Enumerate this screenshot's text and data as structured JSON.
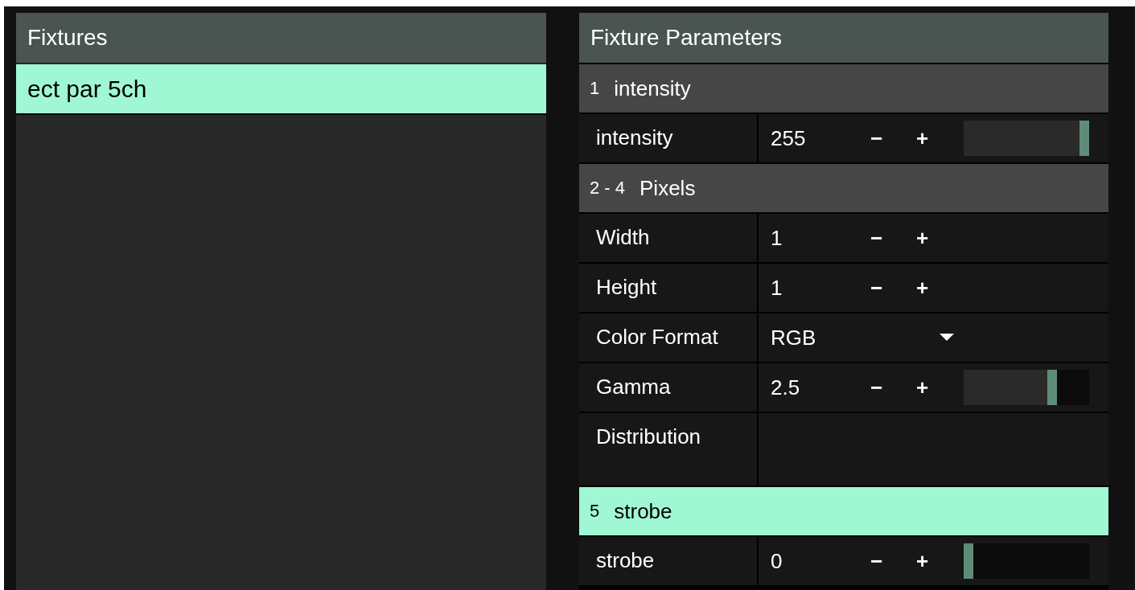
{
  "fixtures_panel": {
    "title": "Fixtures",
    "items": [
      {
        "label": "ect par 5ch",
        "selected": true
      }
    ]
  },
  "parameters_panel": {
    "title": "Fixture Parameters",
    "groups": [
      {
        "channel": "1",
        "name": "intensity",
        "selected": false,
        "params": [
          {
            "kind": "number",
            "label": "intensity",
            "value": "255",
            "minus": "−",
            "plus": "+",
            "level": 1
          }
        ]
      },
      {
        "channel": "2 - 4",
        "name": "Pixels",
        "selected": false,
        "params": [
          {
            "kind": "number",
            "label": "Width",
            "value": "1",
            "minus": "−",
            "plus": "+"
          },
          {
            "kind": "number",
            "label": "Height",
            "value": "1",
            "minus": "−",
            "plus": "+"
          },
          {
            "kind": "select",
            "label": "Color Format",
            "value": "RGB"
          },
          {
            "kind": "number",
            "label": "Gamma",
            "value": "2.5",
            "minus": "−",
            "plus": "+",
            "level": 0.72
          },
          {
            "kind": "empty",
            "label": "Distribution"
          }
        ]
      },
      {
        "channel": "5",
        "name": "strobe",
        "selected": true,
        "params": [
          {
            "kind": "number",
            "label": "strobe",
            "value": "0",
            "minus": "−",
            "plus": "+",
            "level": 0
          }
        ]
      }
    ]
  }
}
